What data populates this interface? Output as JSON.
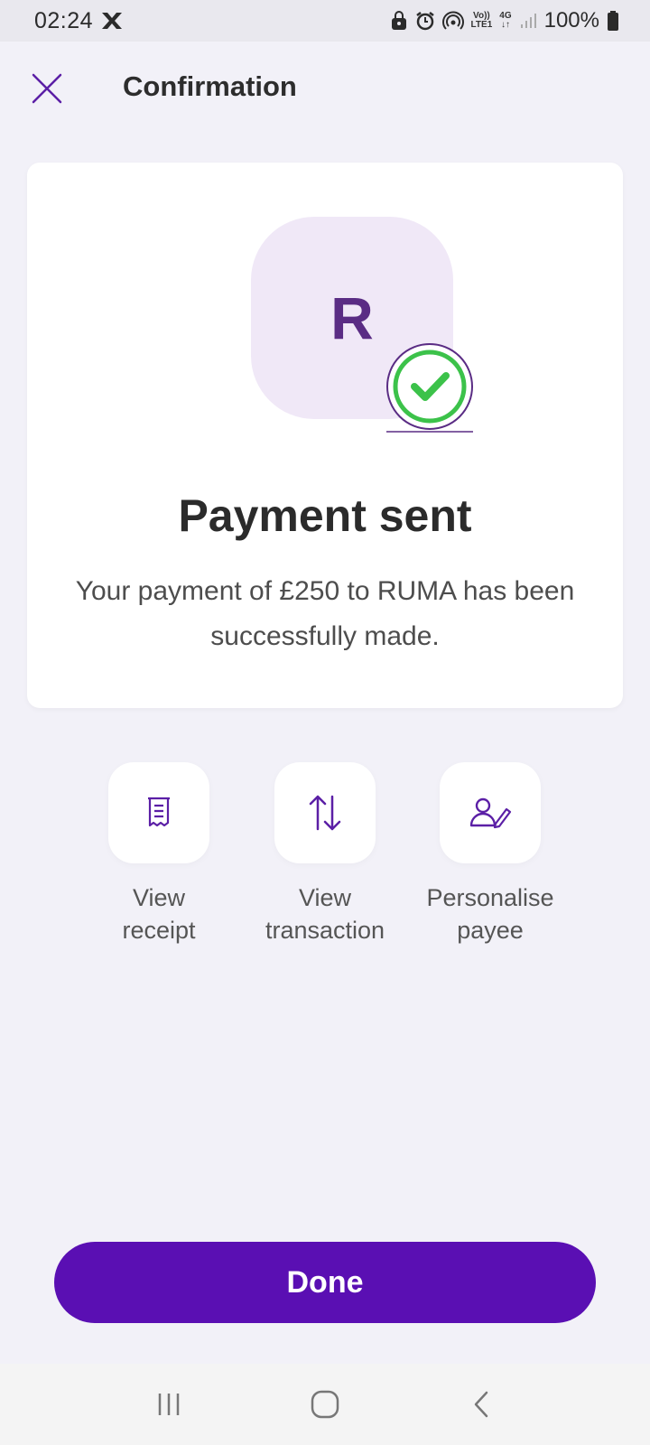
{
  "status_bar": {
    "time": "02:24",
    "network_top": "Vo))",
    "network_bottom": "LTE1",
    "data_top": "4G",
    "data_bottom": "↓↑",
    "battery": "100%"
  },
  "header": {
    "title": "Confirmation"
  },
  "card": {
    "avatar_letter": "R",
    "title": "Payment sent",
    "message": "Your payment of £250 to RUMA has been successfully made."
  },
  "actions": [
    {
      "label": "View\nreceipt",
      "icon": "receipt-icon"
    },
    {
      "label": "View\ntransaction",
      "icon": "transfer-arrows-icon"
    },
    {
      "label": "Personalise\npayee",
      "icon": "edit-user-icon"
    }
  ],
  "done_button": {
    "label": "Done"
  },
  "colors": {
    "brand": "#5a0fb3",
    "accent_icon": "#5b1fa6",
    "success": "#3cc24a",
    "avatar_bg": "#f0e8f7",
    "background": "#f2f1f8"
  }
}
